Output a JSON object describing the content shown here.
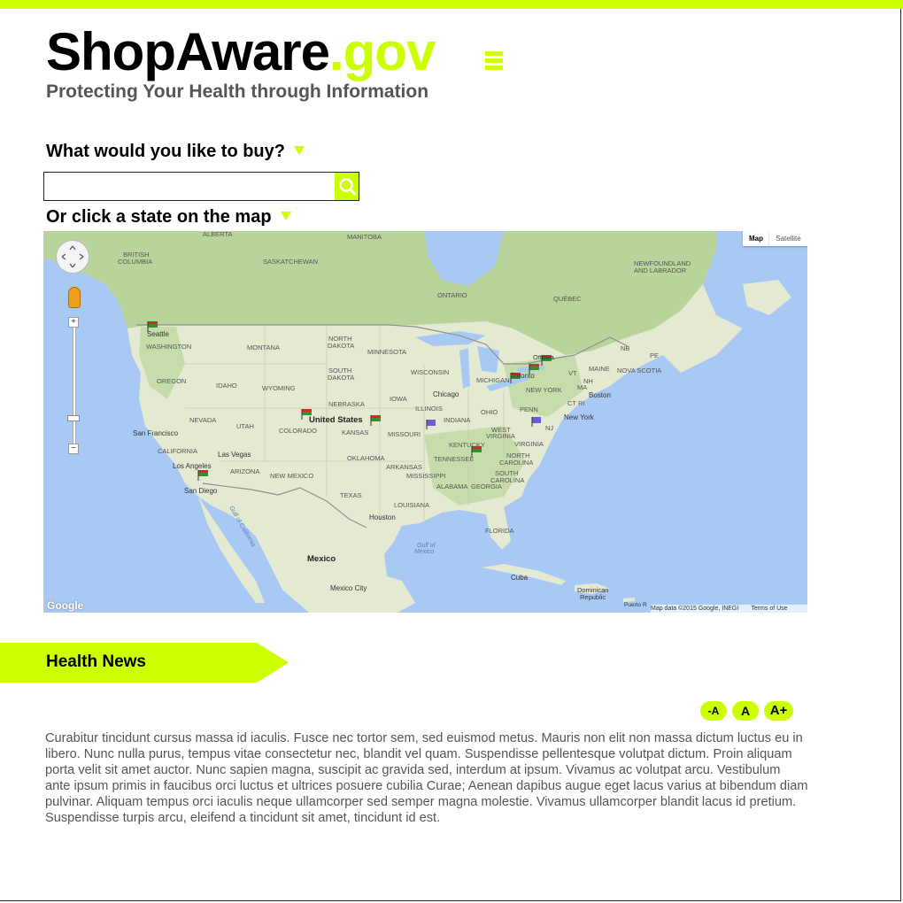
{
  "header": {
    "logo_main": "ShopAware",
    "logo_suffix": ".gov",
    "tagline": "Protecting Your Health through Information",
    "menu_icon": "hamburger-menu-icon"
  },
  "search": {
    "prompt": "What would you like to buy?",
    "value": "",
    "placeholder": "",
    "button_icon": "search-icon"
  },
  "map_section": {
    "prompt": "Or click a state on the map",
    "map_type_map": "Map",
    "map_type_satellite": "Satellite",
    "google_logo": "Google",
    "attribution": "Map data ©2015 Google, INEGI",
    "terms": "Terms of Use",
    "labels": {
      "alberta": "ALBERTA",
      "manitoba": "MANITOBA",
      "british_columbia_1": "BRITISH",
      "british_columbia_2": "COLUMBIA",
      "saskatchewan": "SASKATCHEWAN",
      "ontario": "ONTARIO",
      "quebec": "QUÉBEC",
      "newfoundland_1": "NEWFOUNDLAND",
      "newfoundland_2": "AND LABRADOR",
      "seattle": "Seattle",
      "washington": "WASHINGTON",
      "montana": "MONTANA",
      "north_dakota_1": "NORTH",
      "north_dakota_2": "DAKOTA",
      "minnesota": "MINNESOTA",
      "nb": "NB",
      "pe": "PE",
      "ottawa": "Ottawa",
      "maine": "MAINE",
      "nova_scotia": "NOVA SCOTIA",
      "vt": "VT",
      "nh": "NH",
      "oregon": "OREGON",
      "idaho": "IDAHO",
      "wyoming": "WYOMING",
      "south_dakota_1": "SOUTH",
      "south_dakota_2": "DAKOTA",
      "wisconsin": "WISCONSIN",
      "michigan": "MICHIGAN",
      "toronto": "Toronto",
      "new_york_state": "NEW YORK",
      "ma": "MA",
      "boston": "Boston",
      "ct_ri": "CT RI",
      "chicago": "Chicago",
      "nebraska": "NEBRASKA",
      "iowa": "IOWA",
      "illinois": "ILLINOIS",
      "ohio": "OHIO",
      "penn": "PENN",
      "nj": "NJ",
      "new_york": "New York",
      "nevada": "NEVADA",
      "utah": "UTAH",
      "united_states": "United States",
      "colorado": "COLORADO",
      "kansas": "KANSAS",
      "missouri": "MISSOURI",
      "indiana": "INDIANA",
      "west_virginia_1": "WEST",
      "west_virginia_2": "VIRGINIA",
      "virginia": "VIRGINIA",
      "san_francisco": "San Francisco",
      "california": "CALIFORNIA",
      "las_vegas": "Las Vegas",
      "kentucky": "KENTUCKY",
      "tennessee": "TENNESSEE",
      "north_carolina_1": "NORTH",
      "north_carolina_2": "CAROLINA",
      "los_angeles": "Los Angeles",
      "arizona": "ARIZONA",
      "oklahoma": "OKLAHOMA",
      "arkansas": "ARKANSAS",
      "south_carolina_1": "SOUTH",
      "south_carolina_2": "CAROLINA",
      "san_diego": "San Diego",
      "new_mexico": "NEW MEXICO",
      "mississippi": "MISSISSIPPI",
      "alabama": "ALABAMA",
      "georgia": "GEORGIA",
      "texas": "TEXAS",
      "louisiana": "LOUISIANA",
      "houston": "Houston",
      "florida": "FLORIDA",
      "gulf_of_california": "Gulf of California",
      "gulf_of_mexico_1": "Gulf of",
      "gulf_of_mexico_2": "Mexico",
      "mexico": "Mexico",
      "cuba": "Cuba",
      "mexico_city": "Mexico City",
      "dominican_1": "Dominican",
      "dominican_2": "Republic",
      "puerto_rico": "Puerto R"
    }
  },
  "news": {
    "heading": "Health News",
    "font_decrease": "-A",
    "font_normal": "A",
    "font_increase": "A+",
    "body": "Curabitur tincidunt cursus massa id iaculis. Fusce nec tortor sem, sed euismod metus. Mauris non elit non massa dictum luctus eu in libero. Nunc nulla purus, tempus vitae consectetur nec, blandit vel quam. Suspendisse pellentesque volutpat dictum. Proin aliquam porta velit sit amet auctor. Nunc sapien magna, suscipit ac gravida sed, interdum at ipsum. Vivamus ac volutpat arcu. Vestibulum ante ipsum primis in faucibus orci luctus et ultrices posuere cubilia Curae; Aenean dapibus augue eget lacus varius at bibendum diam pulvinar. Aliquam tempus orci iaculis neque ullamcorper sed semper magna molestie. Vivamus ullamcorper blandit lacus id pretium. Suspendisse turpis arcu, eleifend a tincidunt sit amet, tincidunt id est."
  },
  "colors": {
    "accent": "#ccff00",
    "text": "#000000",
    "muted_text": "#555555",
    "water": "#a9c9f5",
    "land": "#e4e9d2",
    "forest": "#b9d49a"
  }
}
